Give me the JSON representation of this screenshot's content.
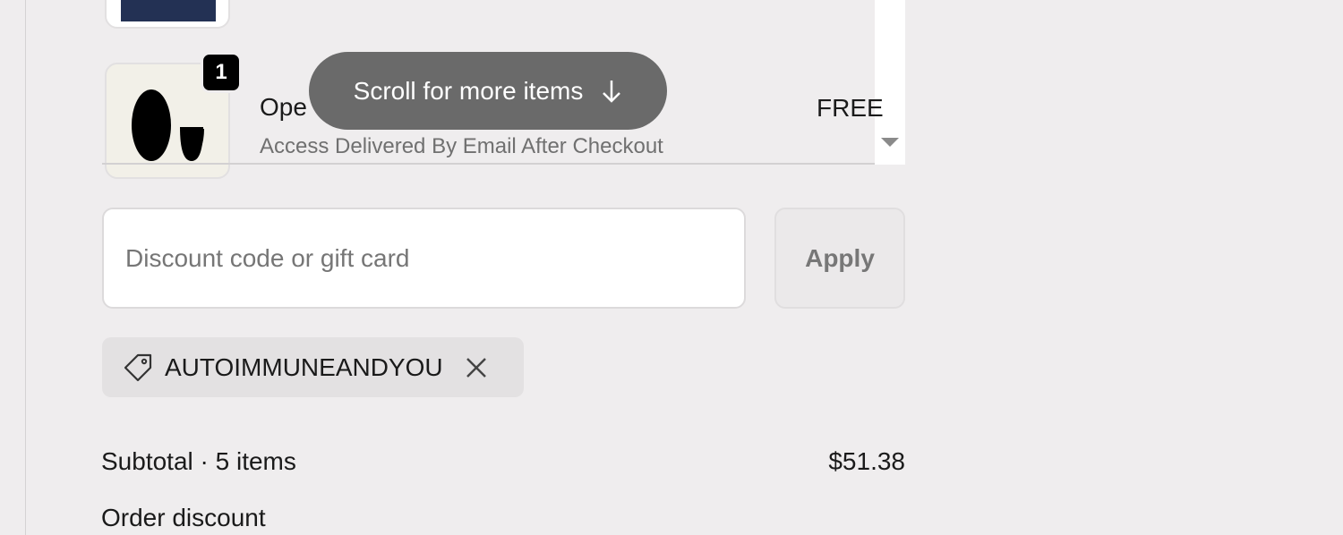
{
  "cart": {
    "items": [
      {
        "name": "Ope",
        "subtitle": "Access Delivered By Email After Checkout",
        "price": "FREE",
        "quantity": "1"
      }
    ],
    "scroll_hint": {
      "label": "Scroll for more items",
      "icon": "arrow-down-icon"
    }
  },
  "discount": {
    "placeholder": "Discount code or gift card",
    "value": "",
    "apply_label": "Apply",
    "applied_code": "AUTOIMMUNEANDYOU",
    "tag_icon": "tag-icon",
    "remove_icon": "close-icon"
  },
  "summary": {
    "subtotal_label": "Subtotal · 5 items",
    "subtotal_value": "$51.38",
    "order_discount_label": "Order discount"
  },
  "colors": {
    "background": "#efedee",
    "pill": "#6a6a6a",
    "thumb_dark": "#233154"
  }
}
